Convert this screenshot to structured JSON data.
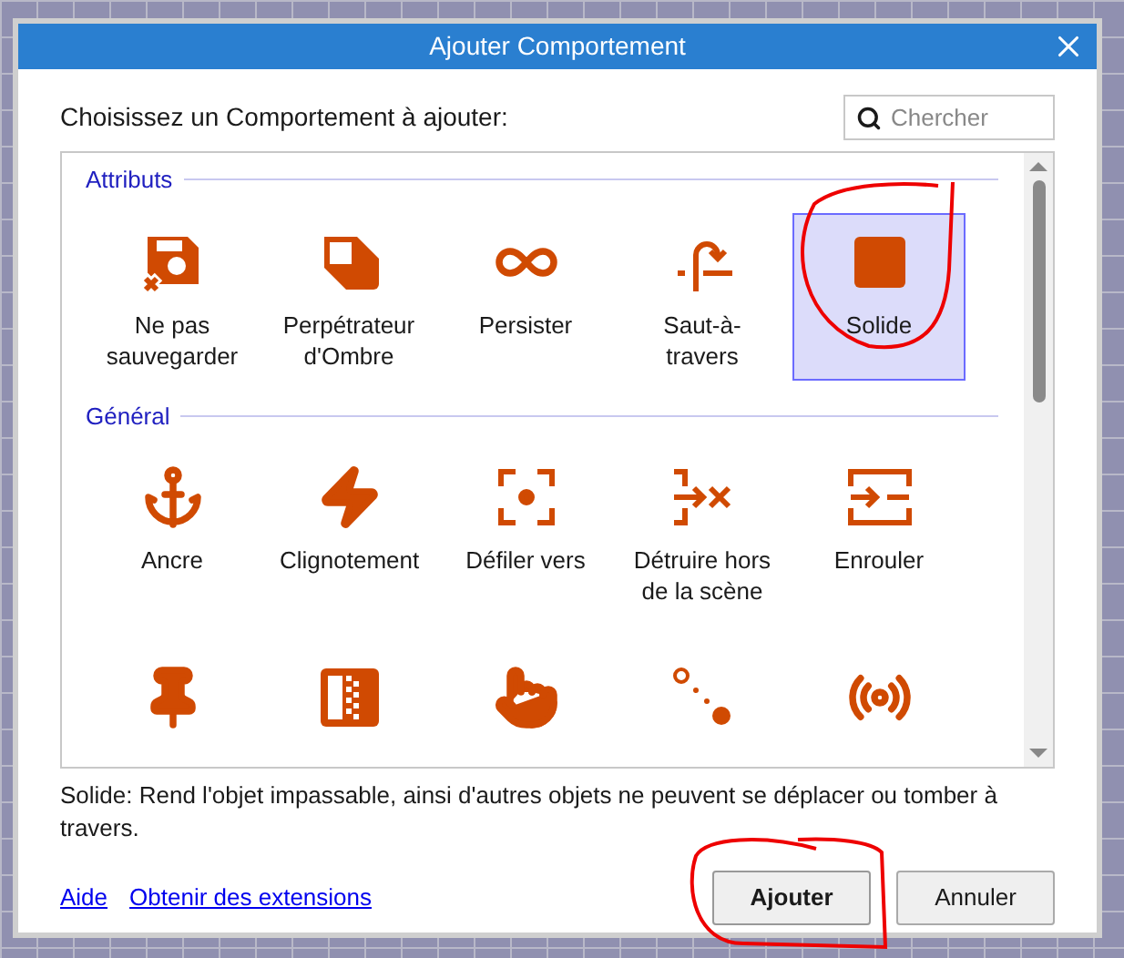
{
  "window": {
    "title": "Ajouter Comportement"
  },
  "prompt": "Choisissez un Comportement à ajouter:",
  "search": {
    "placeholder": "Chercher"
  },
  "sections": [
    {
      "title": "Attributs",
      "items": [
        {
          "label": "Ne pas sauvegarder",
          "selected": false
        },
        {
          "label": "Perpétrateur d'Ombre",
          "selected": false
        },
        {
          "label": "Persister",
          "selected": false
        },
        {
          "label": "Saut-à-travers",
          "selected": false
        },
        {
          "label": "Solide",
          "selected": true
        }
      ]
    },
    {
      "title": "Général",
      "items": [
        {
          "label": "Ancre",
          "selected": false
        },
        {
          "label": "Clignotement",
          "selected": false
        },
        {
          "label": "Défiler vers",
          "selected": false
        },
        {
          "label": "Détruire hors de la scène",
          "selected": false
        },
        {
          "label": "Enrouler",
          "selected": false
        },
        {
          "selected": false
        },
        {
          "selected": false
        },
        {
          "selected": false
        },
        {
          "selected": false
        },
        {
          "selected": false
        }
      ]
    }
  ],
  "description": "Solide: Rend l'objet impassable, ainsi d'autres objets ne peuvent se déplacer ou tomber à travers.",
  "links": [
    "Aide",
    "Obtenir des extensions"
  ],
  "buttons": [
    {
      "label": "Ajouter",
      "kind": "primary"
    },
    {
      "label": "Annuler",
      "kind": "secondary"
    }
  ]
}
